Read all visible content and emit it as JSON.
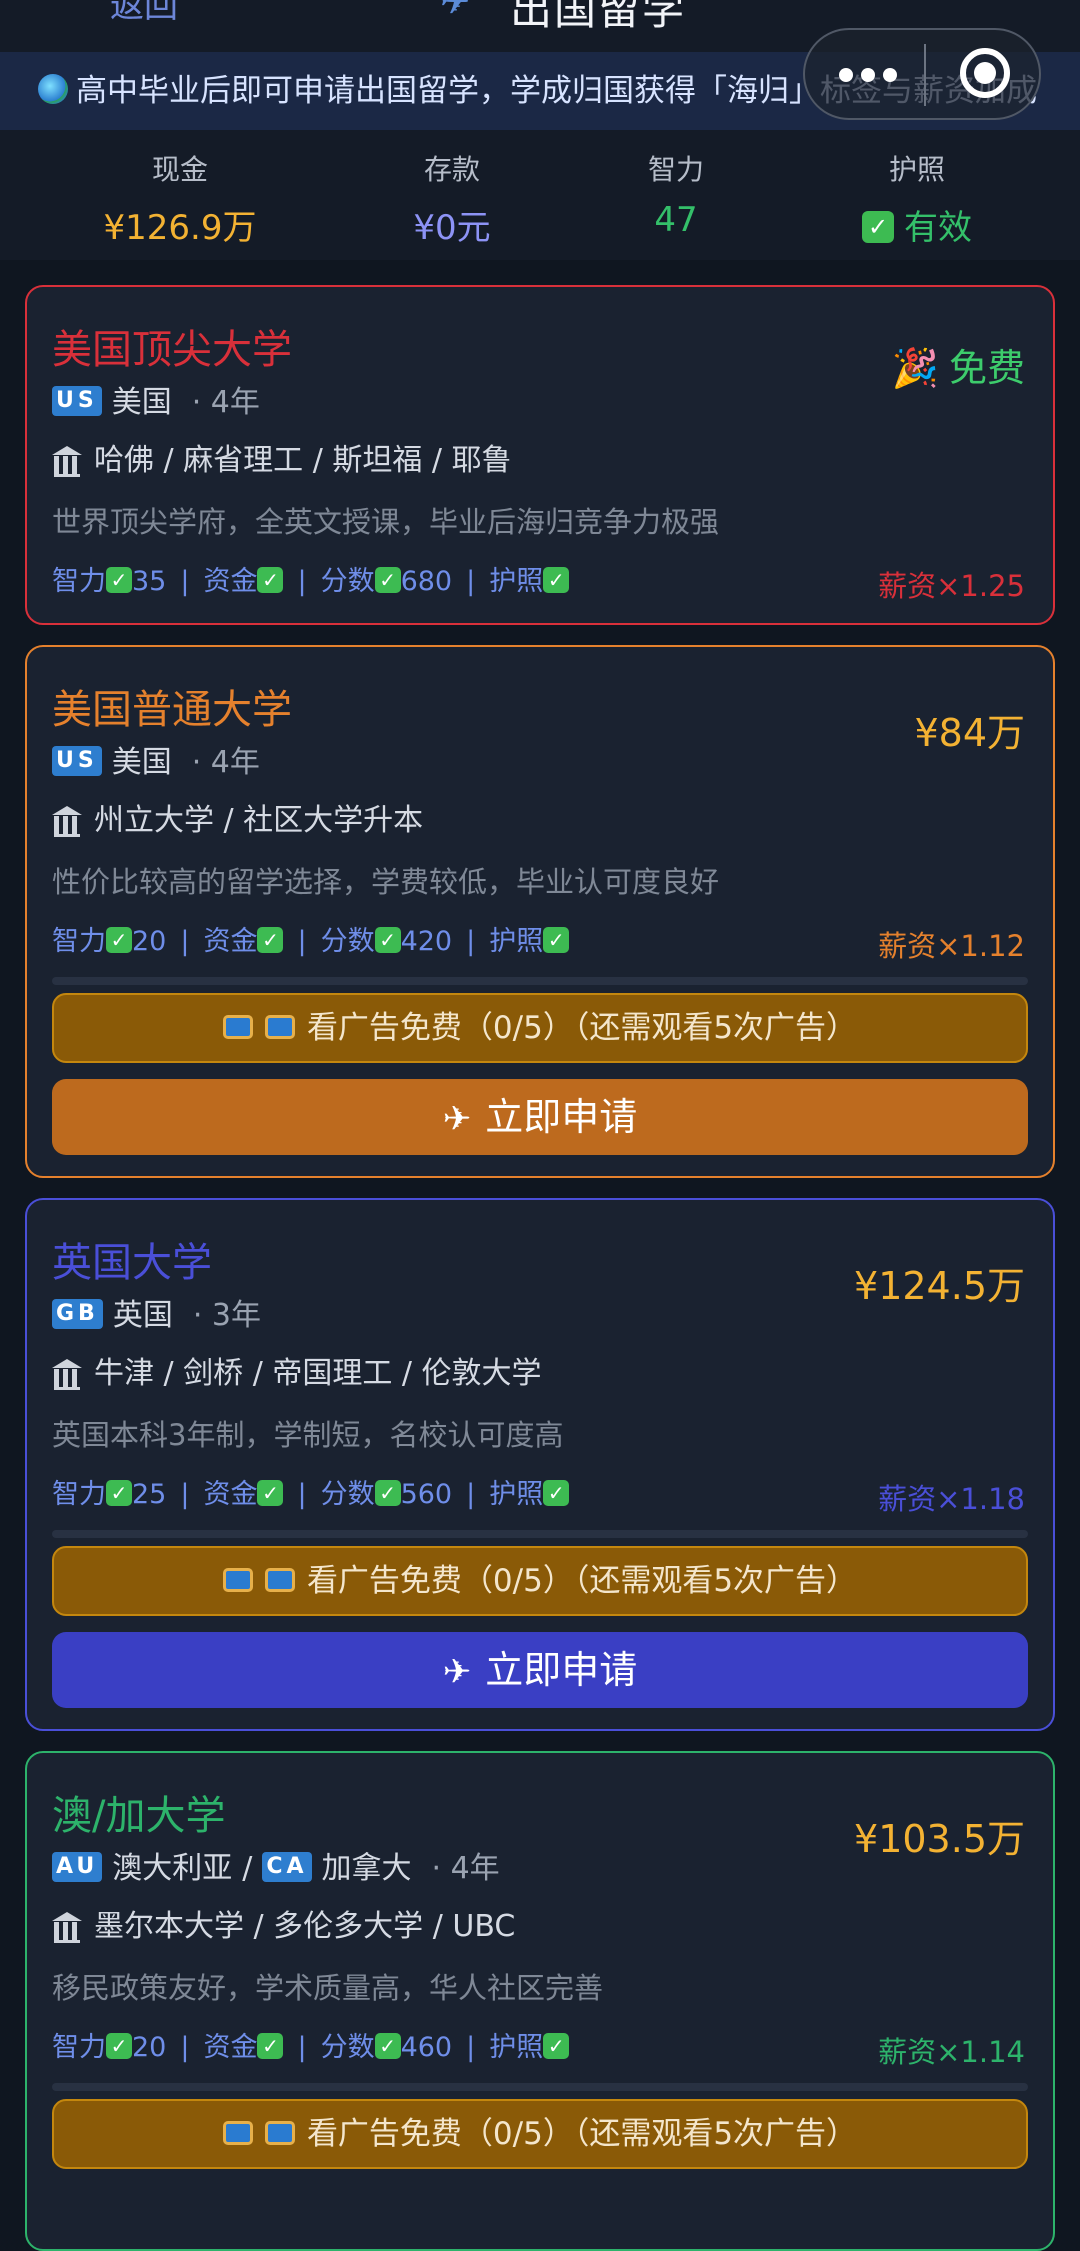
{
  "header": {
    "back_label": "返回",
    "title": "出国留学"
  },
  "notice": {
    "text": "高中毕业后即可申请出国留学，学成归国获得「海归」标签与薪资加成"
  },
  "stats": [
    {
      "label": "现金",
      "value": "¥126.9万",
      "color": "#f3b233"
    },
    {
      "label": "存款",
      "value": "¥0元",
      "color": "#8d93f5"
    },
    {
      "label": "智力",
      "value": "47",
      "color": "#34c06a"
    },
    {
      "label": "护照",
      "value": "有效",
      "color": "#34c06a"
    }
  ],
  "cards": [
    {
      "name": "美国顶尖大学",
      "theme_color": "#d9303a",
      "price": "免费",
      "price_color": "#3dcc6c",
      "flag1": "US",
      "country1": "美国",
      "duration": "· 4年",
      "schools": "哈佛 / 麻省理工 / 斯坦福 / 耶鲁",
      "desc": "世界顶尖学府，全英文授课，毕业后海归竞争力极强",
      "req_iq": "智力",
      "req_iq_val": "35",
      "req_fund": "资金",
      "req_score": "分数",
      "req_score_val": "680",
      "req_passport": "护照",
      "salary": "薪资×1.25"
    },
    {
      "name": "美国普通大学",
      "theme_color": "#e5812d",
      "price": "¥84万",
      "price_color": "#f3b233",
      "flag1": "US",
      "country1": "美国",
      "duration": "· 4年",
      "schools": "州立大学 / 社区大学升本",
      "desc": "性价比较高的留学选择，学费较低，毕业认可度良好",
      "req_iq": "智力",
      "req_iq_val": "20",
      "req_fund": "资金",
      "req_score": "分数",
      "req_score_val": "420",
      "req_passport": "护照",
      "salary": "薪资×1.12",
      "ad_progress": 0,
      "ad_label": "看广告免费（0/5）（还需观看5次广告）",
      "apply_label": "立即申请",
      "apply_color": "#bd6a1e"
    },
    {
      "name": "英国大学",
      "theme_color": "#4a4fd8",
      "price": "¥124.5万",
      "price_color": "#f3b233",
      "flag1": "GB",
      "country1": "英国",
      "duration": "· 3年",
      "schools": "牛津 / 剑桥 / 帝国理工 / 伦敦大学",
      "desc": "英国本科3年制，学制短，名校认可度高",
      "req_iq": "智力",
      "req_iq_val": "25",
      "req_fund": "资金",
      "req_score": "分数",
      "req_score_val": "560",
      "req_passport": "护照",
      "salary": "薪资×1.18",
      "ad_progress": 0,
      "ad_label": "看广告免费（0/5）（还需观看5次广告）",
      "apply_label": "立即申请",
      "apply_color": "#3a3fc4"
    },
    {
      "name": "澳/加大学",
      "theme_color": "#2db36b",
      "price": "¥103.5万",
      "price_color": "#f3b233",
      "flag1": "AU",
      "country1": "澳大利亚",
      "sep": "/",
      "flag2": "CA",
      "country2": "加拿大",
      "duration": "· 4年",
      "schools": "墨尔本大学 / 多伦多大学 / UBC",
      "desc": "移民政策友好，学术质量高，华人社区完善",
      "req_iq": "智力",
      "req_iq_val": "20",
      "req_fund": "资金",
      "req_score": "分数",
      "req_score_val": "460",
      "req_passport": "护照",
      "salary": "薪资×1.14",
      "ad_progress": 0,
      "ad_label": "看广告免费（0/5）（还需观看5次广告）"
    }
  ]
}
